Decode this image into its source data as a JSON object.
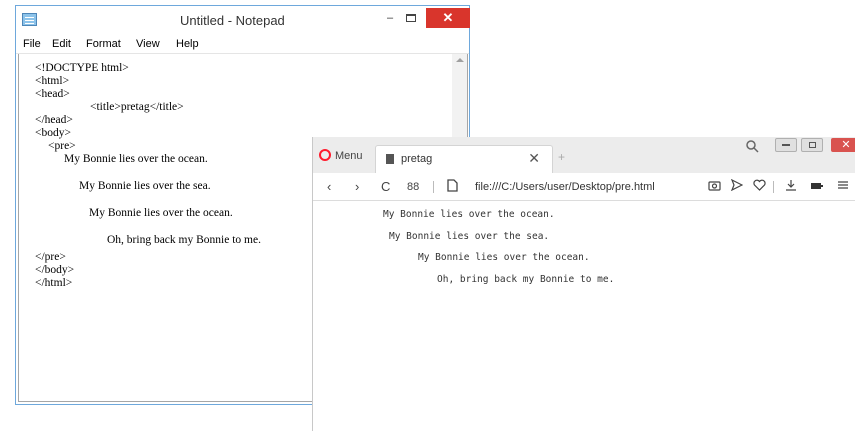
{
  "notepad": {
    "title": "Untitled - Notepad",
    "window_controls": {
      "minimize": "–",
      "close": "✕"
    },
    "menu": [
      "File",
      "Edit",
      "Format",
      "View",
      "Help"
    ],
    "code_lines": [
      "<!DOCTYPE html>",
      "<html>",
      "<head>",
      "<title>pretag</title>",
      "</head>",
      "<body>",
      "<pre>",
      "My Bonnie lies over the ocean.",
      "My Bonnie lies over the sea.",
      "My Bonnie lies over the ocean.",
      "Oh, bring back my Bonnie to me.",
      "</pre>",
      "</body>",
      "</html>"
    ]
  },
  "browser": {
    "menu_label": "Menu",
    "tab_title": "pretag",
    "tab_close": "✕",
    "new_tab": "+",
    "nav": {
      "back": "‹",
      "forward": "›",
      "reload": "C",
      "speed_dial": "88"
    },
    "address": "file:///C:/Users/user/Desktop/pre.html",
    "toolbar_icons": [
      "camera-icon",
      "send-icon",
      "heart-icon",
      "download-icon",
      "battery-icon",
      "menu-icon"
    ],
    "window_controls": {
      "close": "✕"
    },
    "pre_lines": [
      "My Bonnie lies over the ocean.",
      "My Bonnie lies over the sea.",
      "My Bonnie lies over the ocean.",
      "Oh, bring back my Bonnie to me."
    ]
  }
}
